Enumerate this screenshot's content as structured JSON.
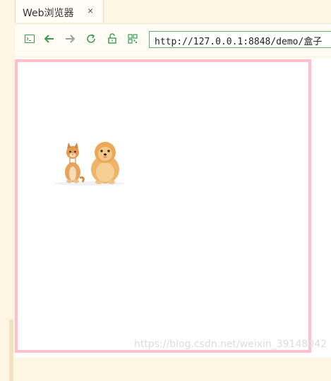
{
  "tab": {
    "title": "Web浏览器",
    "close_glyph": "×"
  },
  "toolbar": {
    "icons": [
      "terminal-icon",
      "back-arrow-icon",
      "forward-arrow-icon",
      "reload-icon",
      "lock-open-icon",
      "qr-grid-icon"
    ],
    "accent_color": "#3a9a52"
  },
  "address": {
    "url": "http://127.0.0.1:8848/demo/盒子"
  },
  "page": {
    "box_border_color": "#ffc0cb",
    "image_icon": "cat-and-dog-image"
  },
  "watermark": {
    "text": "https://blog.csdn.net/weixin_39148042"
  }
}
